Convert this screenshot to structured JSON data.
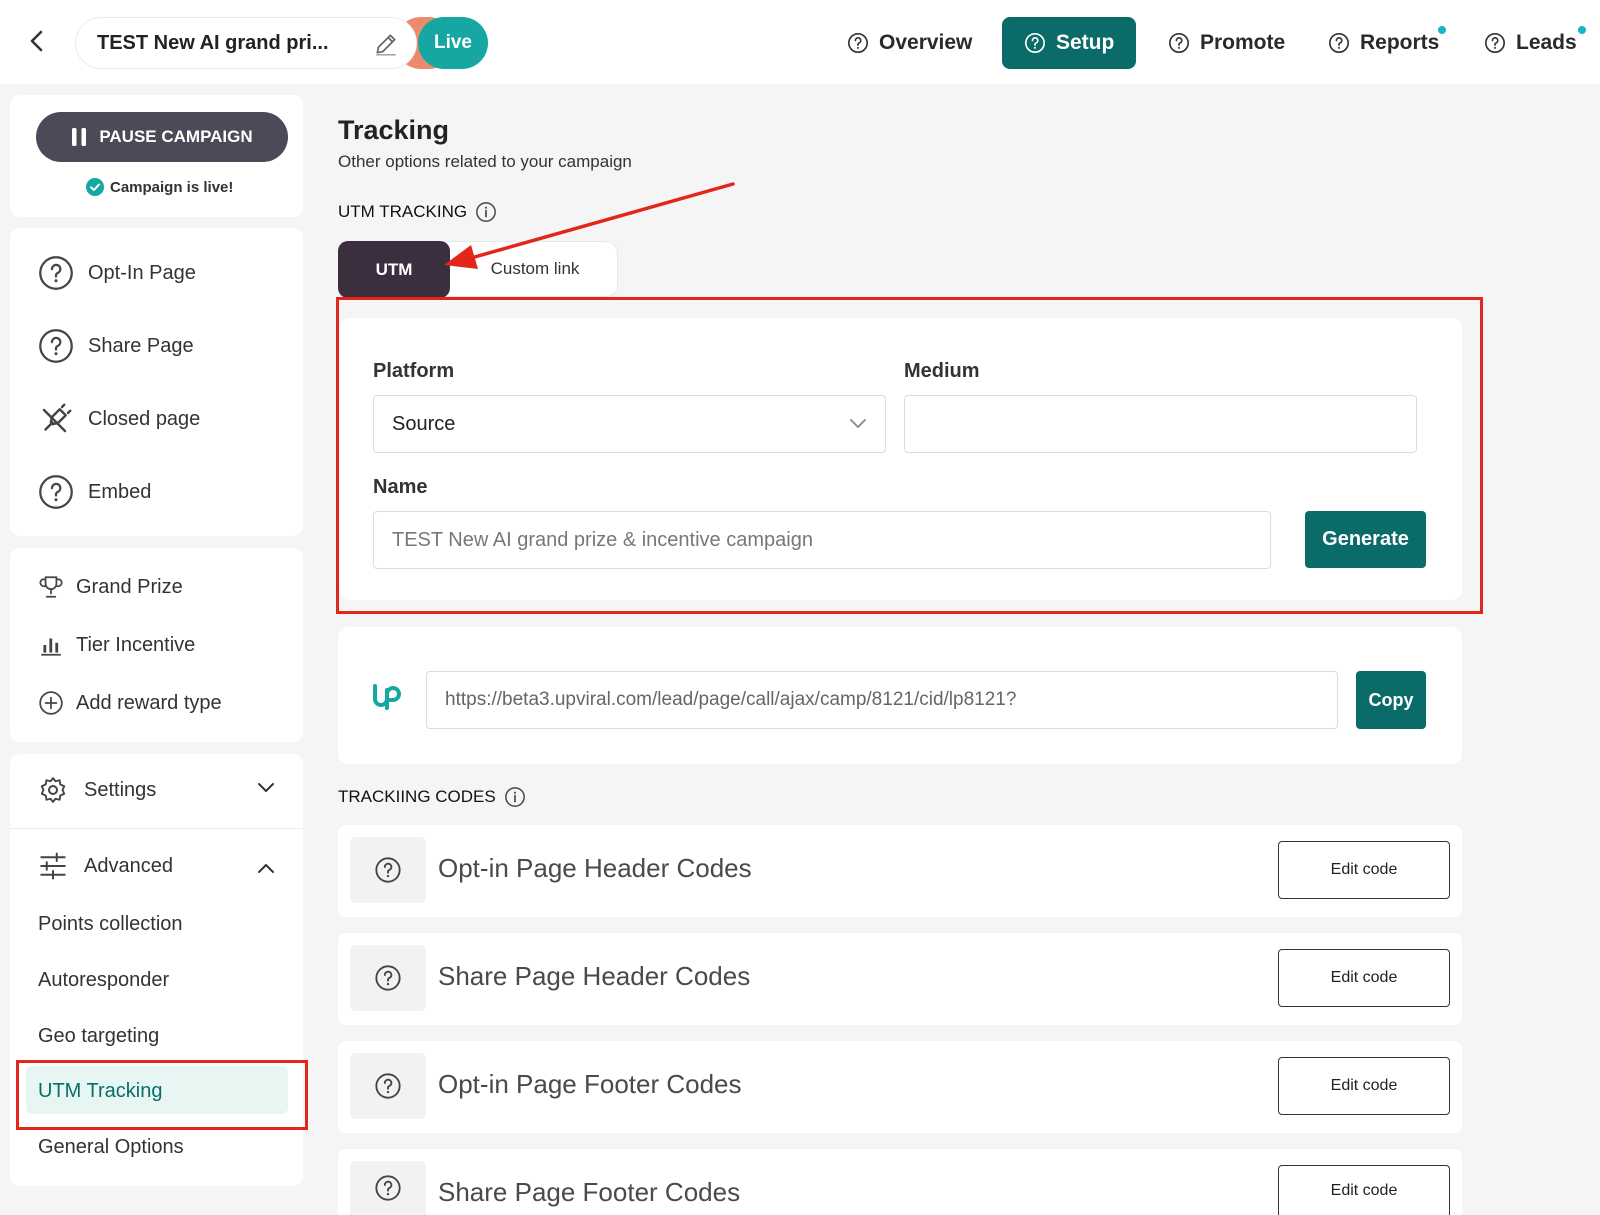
{
  "header": {
    "campaign_title": "TEST New AI grand pri...",
    "live_label": "Live",
    "nav": [
      {
        "label": "Overview"
      },
      {
        "label": "Setup"
      },
      {
        "label": "Promote"
      },
      {
        "label": "Reports"
      },
      {
        "label": "Leads"
      }
    ],
    "active_nav": "Setup"
  },
  "sidebar": {
    "pause_label": "PAUSE CAMPAIGN",
    "live_status": "Campaign is live!",
    "pages": [
      {
        "label": "Opt-In Page",
        "icon": "help-circle-icon"
      },
      {
        "label": "Share Page",
        "icon": "help-circle-icon"
      },
      {
        "label": "Closed page",
        "icon": "plug-off-icon"
      },
      {
        "label": "Embed",
        "icon": "help-circle-icon"
      }
    ],
    "rewards": [
      {
        "label": "Grand Prize",
        "icon": "trophy-icon"
      },
      {
        "label": "Tier Incentive",
        "icon": "bar-chart-icon"
      },
      {
        "label": "Add reward type",
        "icon": "plus-circle-icon"
      }
    ],
    "settings_label": "Settings",
    "advanced_label": "Advanced",
    "advanced_items": [
      {
        "label": "Points collection"
      },
      {
        "label": "Autoresponder"
      },
      {
        "label": "Geo targeting"
      },
      {
        "label": "UTM Tracking"
      },
      {
        "label": "General Options"
      }
    ],
    "active_item": "UTM Tracking"
  },
  "main": {
    "title": "Tracking",
    "subtitle": "Other options related to your campaign",
    "utm_section_label": "UTM TRACKING",
    "tabs": [
      {
        "label": "UTM"
      },
      {
        "label": "Custom link"
      }
    ],
    "active_tab": "UTM",
    "form": {
      "platform_label": "Platform",
      "platform_value": "Source",
      "medium_label": "Medium",
      "medium_value": "",
      "name_label": "Name",
      "name_placeholder": "TEST New AI grand prize & incentive campaign",
      "generate_label": "Generate"
    },
    "url": {
      "value": "https://beta3.upviral.com/lead/page/call/ajax/camp/8121/cid/lp8121?",
      "copy_label": "Copy"
    },
    "codes_section_label": "TRACKIING CODES",
    "codes": [
      {
        "title": "Opt-in Page Header Codes",
        "button": "Edit code"
      },
      {
        "title": "Share Page Header Codes",
        "button": "Edit code"
      },
      {
        "title": "Opt-in Page Footer Codes",
        "button": "Edit code"
      },
      {
        "title": "Share Page Footer Codes",
        "button": "Edit code"
      }
    ]
  },
  "colors": {
    "brand_teal": "#0b6b68",
    "live_teal": "#17a7a2",
    "annotation_red": "#e3261b",
    "tab_dark": "#3b2f3f"
  }
}
